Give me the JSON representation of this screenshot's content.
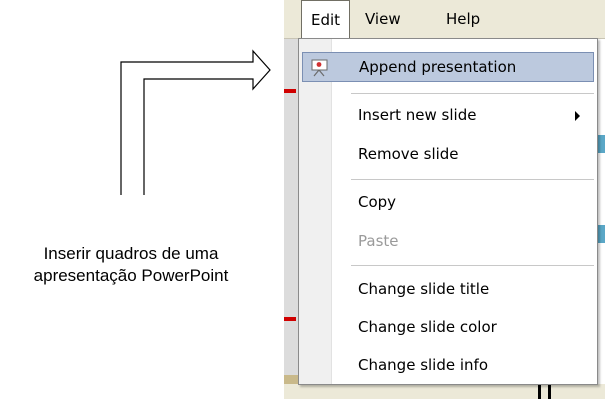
{
  "caption": {
    "line1": "Inserir quadros de uma",
    "line2": "apresentação PowerPoint"
  },
  "menubar": {
    "items": [
      {
        "label": "Edit",
        "active": true
      },
      {
        "label": "View",
        "active": false
      },
      {
        "label": "Help",
        "active": false
      }
    ]
  },
  "edit_menu": {
    "items": [
      {
        "label": "Append presentation",
        "icon": "presentation-icon",
        "highlighted": true
      },
      {
        "label": "Insert new slide",
        "submenu": true
      },
      {
        "label": "Remove slide"
      },
      {
        "label": "Copy"
      },
      {
        "label": "Paste",
        "disabled": true
      },
      {
        "label": "Change slide title"
      },
      {
        "label": "Change slide color"
      },
      {
        "label": "Change slide info"
      }
    ]
  },
  "colors": {
    "highlight": "#bcc9de",
    "highlight_border": "#7b8fb3",
    "disabled_text": "#9a9a9a",
    "menubar_bg": "#ece9d8"
  }
}
